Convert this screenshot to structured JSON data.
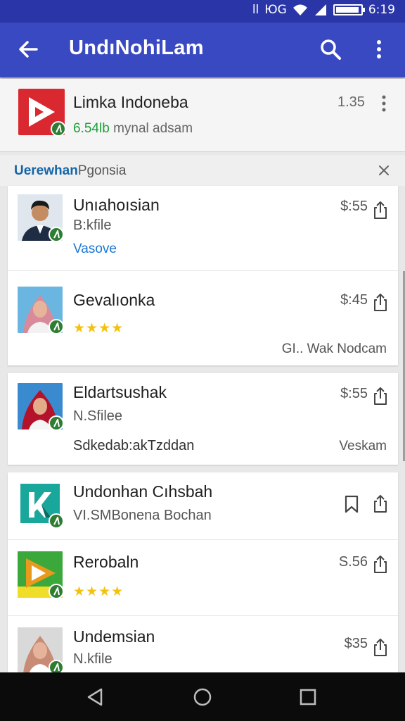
{
  "status": {
    "signal_text": "ll",
    "alarm_text": "ЮG",
    "time": "6:19"
  },
  "appbar": {
    "title": "UndıNohiLam"
  },
  "featured": {
    "name": "Limka Indoneba",
    "sub_green": "6.54lb",
    "sub_rest": "mynal adsam",
    "price": "1.35"
  },
  "section": {
    "label_bold": "Uerewhan",
    "label_rest": "Pgonsia"
  },
  "items": [
    {
      "name": "Unıahoısian",
      "sub": "B:kfile",
      "link": "Vasove",
      "price": "$:55"
    },
    {
      "name": "Gevalıonka",
      "stars": "★★★★",
      "footer_right": "GI.. Wak Nodcam",
      "price": "$:45"
    },
    {
      "name": "Eldartsushak",
      "sub": "N.Sfilee",
      "footer_left": "Sdkedab:akTzddan",
      "footer_right": "Veskam",
      "price": "$:55"
    },
    {
      "name": "Undonhan Cıhsbah",
      "sub": "VI.SMBonena Bochan"
    },
    {
      "name": "Rerobaln",
      "stars": "★★★★",
      "price": "S.56"
    },
    {
      "name": "Undemsian",
      "sub": "N.kfile",
      "price": "$35"
    }
  ],
  "colors": {
    "status_bar": "#2a36a8",
    "app_bar": "#3949c1",
    "accent_green": "#1e9e3a",
    "link_blue": "#1976d2",
    "star": "#f4c20d"
  },
  "icons": [
    "back-arrow-icon",
    "search-icon",
    "more-vert-icon",
    "close-icon",
    "share-icon",
    "bookmark-icon",
    "nav-back-icon",
    "nav-home-icon",
    "nav-recents-icon"
  ]
}
